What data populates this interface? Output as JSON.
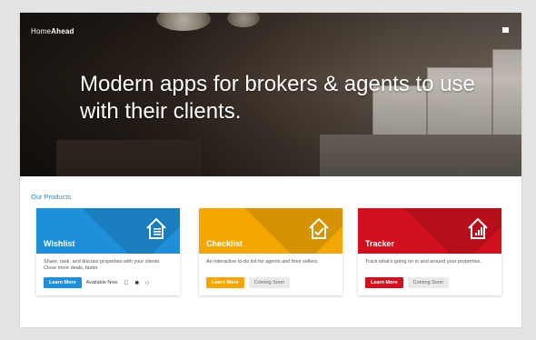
{
  "brand": {
    "prefix": "Home",
    "bold": "Ahead"
  },
  "hero": {
    "headline": "Modern apps for brokers & agents to use with their clients."
  },
  "section": {
    "title": "Our Products"
  },
  "colors": {
    "accent": "#1a8fd6",
    "wishlist": "#1e8fd8",
    "checklist": "#f4a700",
    "tracker": "#d0101e"
  },
  "products": [
    {
      "name": "Wishlist",
      "description": "Share, rank, and discuss properties with your clients. Close more deals, faster.",
      "learn_label": "Learn More",
      "status": "Available Now",
      "icon": "house-list-icon"
    },
    {
      "name": "Checklist",
      "description": "An interactive to-do list for agents and their sellers.",
      "learn_label": "Learn More",
      "status": "Coming Soon",
      "icon": "house-check-icon"
    },
    {
      "name": "Tracker",
      "description": "Track what's going on in and around your properties.",
      "learn_label": "Learn More",
      "status": "Coming Soon",
      "icon": "house-chart-icon"
    }
  ],
  "platform_icons": [
    "apple-icon",
    "android-icon",
    "web-icon"
  ]
}
